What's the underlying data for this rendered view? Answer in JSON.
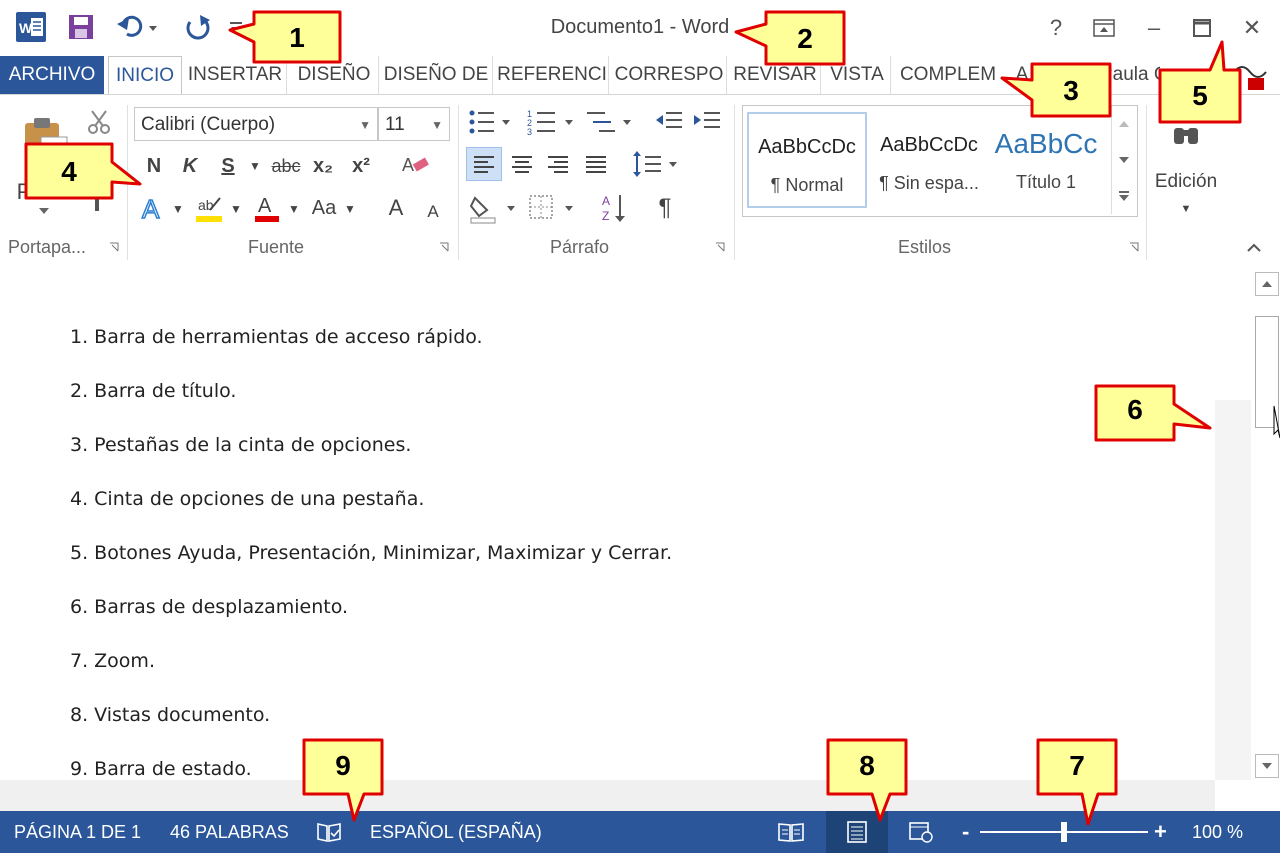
{
  "titlebar": {
    "title": "Documento1 - Word",
    "help": "?",
    "minimize": "–",
    "close": "✕"
  },
  "tabs": [
    "ARCHIVO",
    "INICIO",
    "INSERTAR",
    "DISEÑO",
    "DISEÑO DE",
    "REFERENCI",
    "CORRESPO",
    "REVISAR",
    "VISTA",
    "COMPLEM",
    "A",
    "Paula Gi"
  ],
  "ribbon": {
    "font_name": "Calibri (Cuerpo)",
    "font_size": "11",
    "styles": [
      {
        "preview": "AaBbCcDc",
        "name": "¶ Normal"
      },
      {
        "preview": "AaBbCcDc",
        "name": "¶ Sin espa..."
      },
      {
        "preview": "AaBbCc",
        "name": "Título 1"
      }
    ],
    "editing_label": "Edición",
    "groups": {
      "clipboard": "Portapa...",
      "font": "Fuente",
      "paragraph": "Párrafo",
      "styles": "Estilos"
    },
    "buttons": {
      "bold": "N",
      "italic": "K",
      "underline": "S",
      "strike": "abc",
      "sub": "x₂",
      "sup": "x²",
      "font_color_a": "A",
      "change_case": "Aa",
      "grow": "A",
      "shrink": "A",
      "pilcrow": "¶",
      "paste_letter": "P"
    }
  },
  "document": {
    "items": [
      "1. Barra de  herramientas de acceso rápido.",
      "2. Barra de título.",
      "3. Pestañas de la cinta de opciones.",
      "4. Cinta de opciones de una  pestaña.",
      "5. Botones Ayuda, Presentación, Minimizar, Maximizar y Cerrar.",
      "6. Barras de desplazamiento.",
      "7. Zoom.",
      "8. Vistas documento.",
      "9. Barra de estado."
    ]
  },
  "statusbar": {
    "page": "PÁGINA 1 DE 1",
    "words": "46 PALABRAS",
    "language": "ESPAÑOL (ESPAÑA)",
    "zoom_minus": "-",
    "zoom_plus": "+",
    "zoom": "100 %",
    "zoom_level": 100
  },
  "callouts": [
    "1",
    "2",
    "3",
    "4",
    "5",
    "6",
    "7",
    "8",
    "9"
  ],
  "colors": {
    "brand": "#2b579a",
    "callout_fill": "#ffff99",
    "callout_border": "#e00000"
  }
}
